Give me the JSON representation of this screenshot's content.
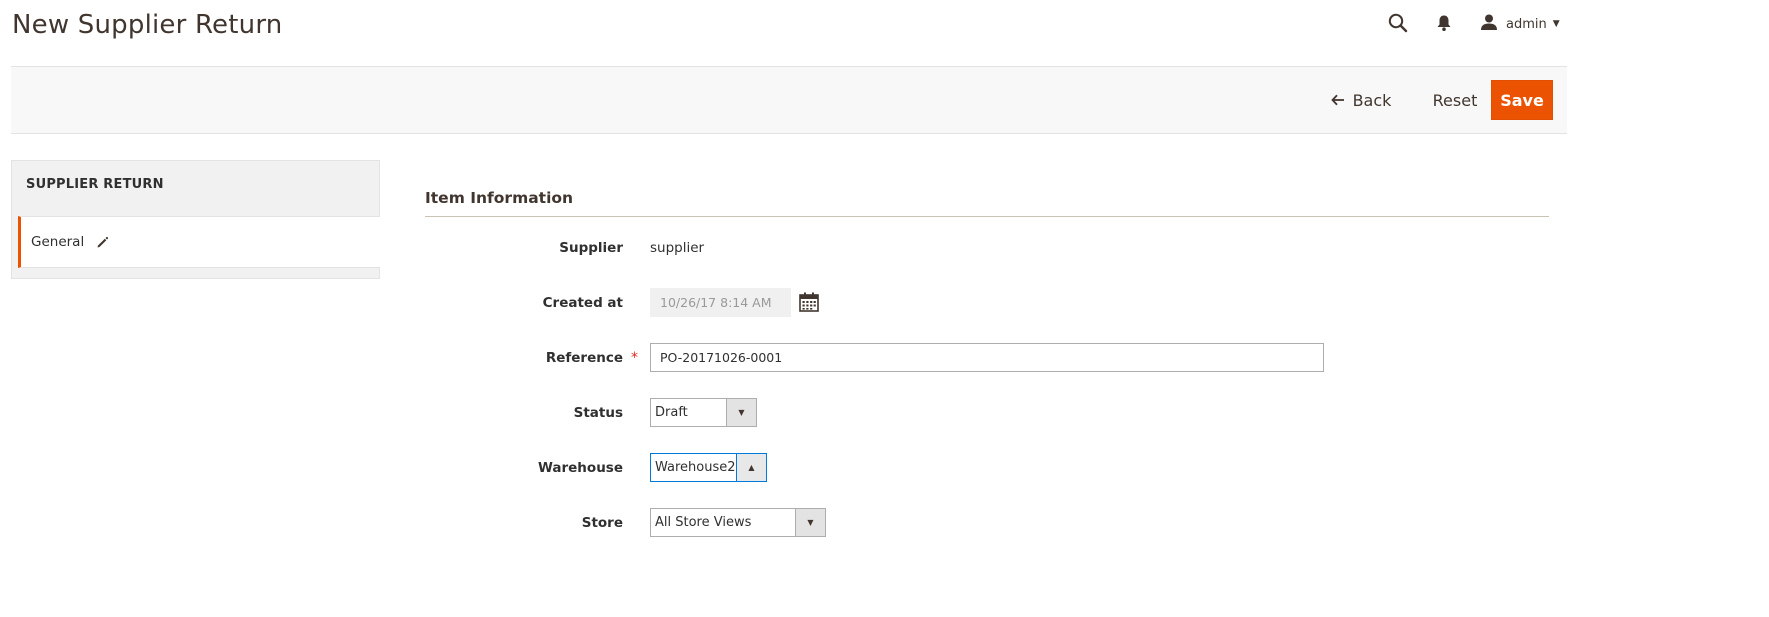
{
  "header": {
    "title": "New Supplier Return",
    "user_name": "admin"
  },
  "action_bar": {
    "back_label": "Back",
    "reset_label": "Reset",
    "save_label": "Save"
  },
  "sidebar": {
    "title": "SUPPLIER RETURN",
    "items": [
      {
        "label": "General",
        "active": true
      }
    ]
  },
  "form": {
    "section_title": "Item Information",
    "fields": {
      "supplier": {
        "label": "Supplier",
        "value": "supplier"
      },
      "created_at": {
        "label": "Created at",
        "value": "10/26/17 8:14 AM"
      },
      "reference": {
        "label": "Reference",
        "value": "PO-20171026-0001",
        "required_mark": "*"
      },
      "status": {
        "label": "Status",
        "value": "Draft"
      },
      "warehouse": {
        "label": "Warehouse",
        "value": "Warehouse2"
      },
      "store": {
        "label": "Store",
        "value": "All Store Views"
      }
    }
  },
  "colors": {
    "accent": "#eb5202",
    "focus": "#007bdb",
    "required": "#e22626"
  },
  "icons": {
    "search": "search-icon",
    "notifications": "bell-icon",
    "user": "user-icon",
    "back": "arrow-left-icon",
    "edit": "pencil-icon",
    "calendar": "calendar-icon"
  }
}
